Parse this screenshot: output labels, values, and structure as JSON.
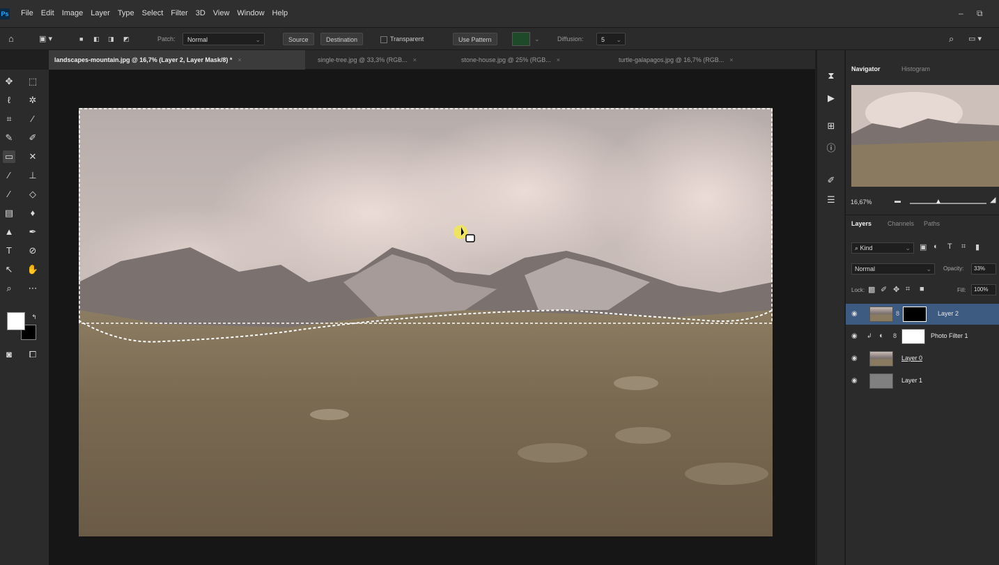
{
  "app": {
    "logo": "Ps"
  },
  "menu": {
    "items": [
      "File",
      "Edit",
      "Image",
      "Layer",
      "Type",
      "Select",
      "Filter",
      "3D",
      "View",
      "Window",
      "Help"
    ]
  },
  "options_bar": {
    "patch_label": "Patch:",
    "patch_value": "Normal",
    "source_label": "Source",
    "destination_label": "Destination",
    "transparent_label": "Transparent",
    "use_pattern_label": "Use Pattern",
    "diffusion_label": "Diffusion:",
    "diffusion_value": "5"
  },
  "tabs": [
    {
      "label": "landscapes-mountain.jpg @ 16,7% (Layer 2, Layer Mask/8) *",
      "active": true
    },
    {
      "label": "single-tree.jpg @ 33,3% (RGB...",
      "active": false
    },
    {
      "label": "stone-house.jpg @ 25% (RGB...",
      "active": false
    },
    {
      "label": "turtle-galapagos.jpg @ 16,7% (RGB...",
      "active": false
    }
  ],
  "navigator": {
    "tab_active": "Navigator",
    "tab_other": "Histogram",
    "zoom": "16,67%"
  },
  "layers_panel": {
    "tabs": [
      "Layers",
      "Channels",
      "Paths"
    ],
    "filter_kind": "Kind",
    "blend_mode": "Normal",
    "opacity_label": "Opacity:",
    "opacity_value": "33%",
    "lock_label": "Lock:",
    "fill_label": "Fill:",
    "fill_value": "100%",
    "layers": [
      {
        "name": "Layer 2",
        "selected": true
      },
      {
        "name": "Photo Filter 1",
        "selected": false
      },
      {
        "name": "Layer 0",
        "selected": false
      },
      {
        "name": "Layer 1",
        "selected": false
      }
    ]
  },
  "colors": {
    "accent": "#3d5a80",
    "foreground": "#ffffff",
    "background": "#000000"
  }
}
